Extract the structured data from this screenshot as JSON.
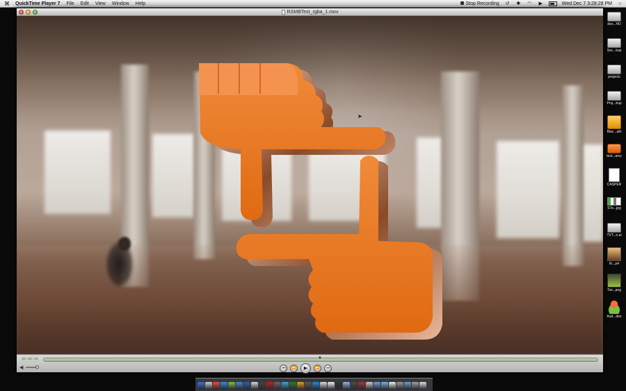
{
  "menubar": {
    "apple": "",
    "app_name": "QuickTime Player 7",
    "menus": [
      "File",
      "Edit",
      "View",
      "Window",
      "Help"
    ],
    "stop_recording": "Stop Recording",
    "datetime": "Wed Dec 7  3:28:28 PM"
  },
  "window": {
    "title": "RSMBTest_rgba_1.mov"
  },
  "controls": {
    "time": "00:00:00",
    "playback_progress": 0.0,
    "volume_level": 0.8
  },
  "desktop_icons": [
    {
      "label": "des...HD",
      "icon": "drive-icon",
      "kind": "drive"
    },
    {
      "label": "Sec...kup",
      "icon": "drive-icon",
      "kind": "drive"
    },
    {
      "label": "projects",
      "icon": "drive-icon",
      "kind": "drive"
    },
    {
      "label": "Proj...kup",
      "icon": "drive-icon",
      "kind": "drive"
    },
    {
      "label": "Blac...ath",
      "icon": "usb-drive-icon",
      "kind": "usb"
    },
    {
      "label": "test...amy",
      "icon": "orange-drive-icon",
      "kind": "orange"
    },
    {
      "label": "CASPER",
      "icon": "document-icon",
      "kind": "doc"
    },
    {
      "label": "STo...jpg",
      "icon": "image-strip-icon",
      "kind": "strip"
    },
    {
      "label": "TVT...n.ai",
      "icon": "drive-icon",
      "kind": "drive"
    },
    {
      "label": "Ki...p4",
      "icon": "movie-icon",
      "kind": "img"
    },
    {
      "label": "Twi...png",
      "icon": "png-image-icon",
      "kind": "png"
    },
    {
      "label": "Aud...des",
      "icon": "android-icon",
      "kind": "android"
    }
  ],
  "dock": {
    "colors": [
      "#3b6fd6",
      "#cccccc",
      "#e94b3c",
      "#2f8fe0",
      "#7ac142",
      "#4f86c6",
      "#2b5fa8",
      "#d8d8d8",
      "#444444",
      "#c21f1f",
      "#6a6a6a",
      "#3aa3dd",
      "#2a7d3b",
      "#e0a020",
      "#5a5a5a",
      "#1e88e5",
      "#dddddd",
      "#f0f0f0",
      "#333333",
      "#8ab6e8",
      "#4b4b4b",
      "#aa3333",
      "#cccccc",
      "#6f9fd8",
      "#7ab0e0",
      "#eeeeee",
      "#999999",
      "#6b9bd1",
      "#a0a0a0",
      "#dddddd"
    ]
  },
  "theme": {
    "logo_orange": "#e8741c",
    "logo_dark": "#b24d09"
  }
}
